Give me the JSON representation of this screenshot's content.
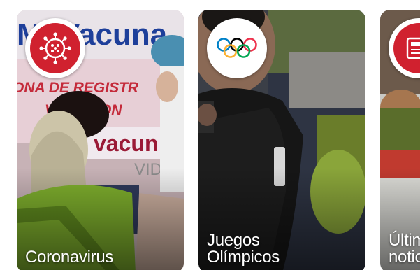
{
  "cards": [
    {
      "label": "Coronavirus",
      "icon": "virus-icon"
    },
    {
      "label": "Juegos\nOlímpicos",
      "icon": "olympic-rings-icon"
    },
    {
      "label": "Últimas\nnoticias",
      "icon": "newspaper-icon"
    }
  ],
  "photo_text": {
    "sign_top": "Mi Vacuna",
    "sign_mid_1": "ONA DE REGISTR",
    "sign_mid_2": "VACACION",
    "sign_low": "vacun",
    "sign_covid": "VID-1"
  },
  "colors": {
    "accent_red": "#d0212f",
    "olympic_blue": "#0081c8",
    "olympic_yellow": "#fcb131",
    "olympic_black": "#000000",
    "olympic_green": "#00a651",
    "olympic_red": "#ee334e"
  }
}
